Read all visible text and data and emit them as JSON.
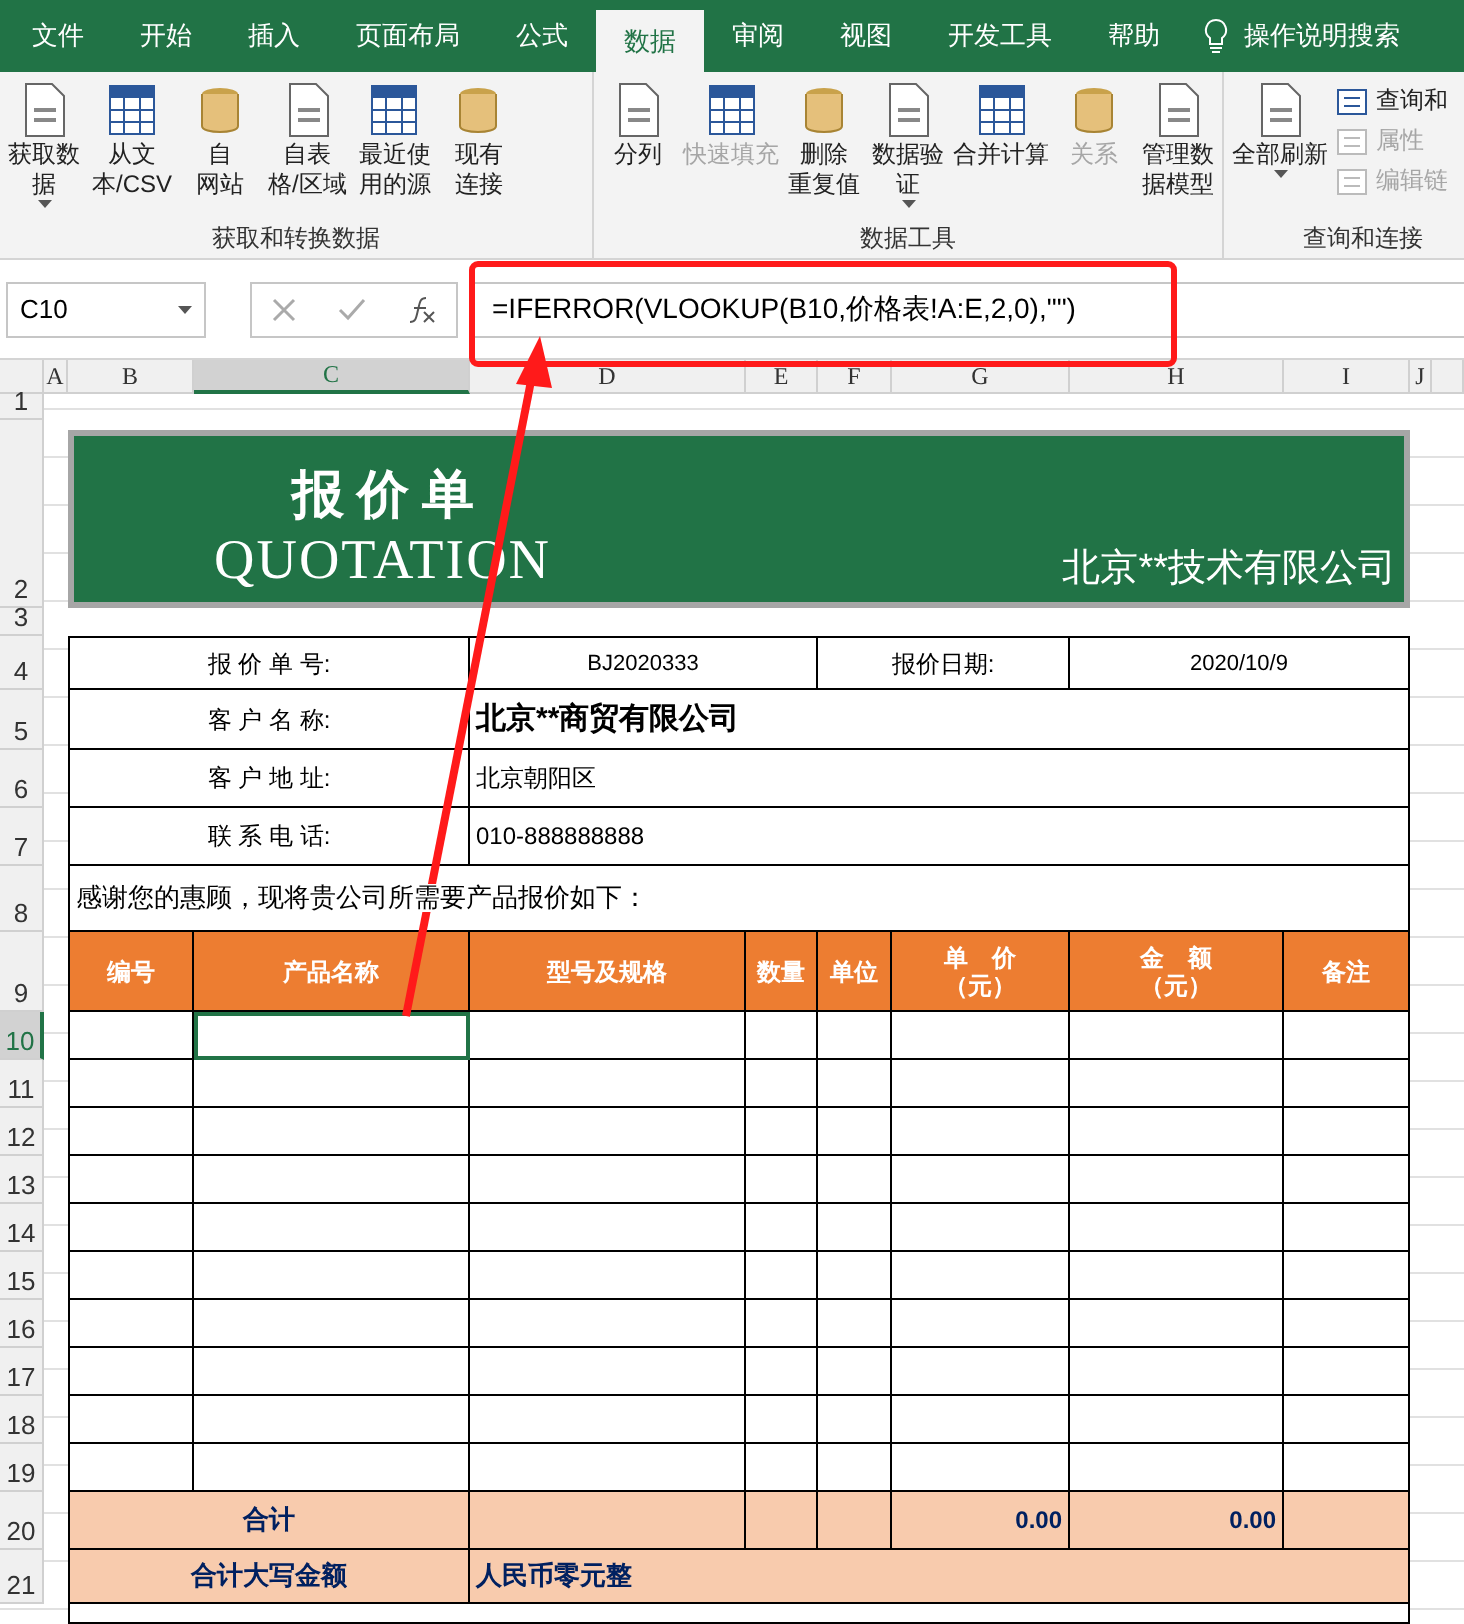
{
  "tabs": [
    {
      "label": "文件",
      "selected": false
    },
    {
      "label": "开始",
      "selected": false
    },
    {
      "label": "插入",
      "selected": false
    },
    {
      "label": "页面布局",
      "selected": false
    },
    {
      "label": "公式",
      "selected": false
    },
    {
      "label": "数据",
      "selected": true
    },
    {
      "label": "审阅",
      "selected": false
    },
    {
      "label": "视图",
      "selected": false
    },
    {
      "label": "开发工具",
      "selected": false
    },
    {
      "label": "帮助",
      "selected": false
    }
  ],
  "search": {
    "label": "操作说明搜索"
  },
  "ribbon_groups": [
    {
      "label": "获取和转换数据",
      "buttons": [
        {
          "kind": "dropdown",
          "lines": [
            "获取数",
            "据"
          ],
          "disabled": false
        },
        {
          "kind": "large",
          "lines": [
            "从文",
            "本/CSV"
          ],
          "disabled": false
        },
        {
          "kind": "large",
          "lines": [
            "自",
            "网站"
          ],
          "disabled": false
        },
        {
          "kind": "large",
          "lines": [
            "自表",
            "格/区域"
          ],
          "disabled": false
        },
        {
          "kind": "large",
          "lines": [
            "最近使",
            "用的源"
          ],
          "disabled": false
        },
        {
          "kind": "large",
          "lines": [
            "现有",
            "连接"
          ],
          "disabled": false
        }
      ]
    },
    {
      "label": "数据工具",
      "buttons": [
        {
          "kind": "large",
          "lines": [
            "分列"
          ],
          "disabled": false
        },
        {
          "kind": "large",
          "lines": [
            "快速填充"
          ],
          "disabled": true
        },
        {
          "kind": "large",
          "lines": [
            "删除",
            "重复值"
          ],
          "disabled": false
        },
        {
          "kind": "dropdown",
          "lines": [
            "数据验",
            "证"
          ],
          "disabled": false
        },
        {
          "kind": "large",
          "lines": [
            "合并计算"
          ],
          "disabled": false
        },
        {
          "kind": "large",
          "lines": [
            "关系"
          ],
          "disabled": true
        },
        {
          "kind": "large",
          "lines": [
            "管理数",
            "据模型"
          ],
          "disabled": false
        }
      ]
    },
    {
      "label": "查询和连接",
      "buttons": [
        {
          "kind": "dropdown",
          "lines": [
            "全部刷新"
          ],
          "disabled": false
        },
        {
          "kind": "small",
          "lines": [
            "查询和"
          ],
          "disabled": false
        },
        {
          "kind": "small",
          "lines": [
            "属性"
          ],
          "disabled": true
        },
        {
          "kind": "small",
          "lines": [
            "编辑链"
          ],
          "disabled": true
        }
      ]
    }
  ],
  "name_box": "C10",
  "formula": "=IFERROR(VLOOKUP(B10,价格表!A:E,2,0),\"\")",
  "columns": [
    {
      "label": "A",
      "selected": false
    },
    {
      "label": "B",
      "selected": false
    },
    {
      "label": "C",
      "selected": true
    },
    {
      "label": "D",
      "selected": false
    },
    {
      "label": "E",
      "selected": false
    },
    {
      "label": "F",
      "selected": false
    },
    {
      "label": "G",
      "selected": false
    },
    {
      "label": "H",
      "selected": false
    },
    {
      "label": "I",
      "selected": false
    },
    {
      "label": "J",
      "selected": false
    }
  ],
  "rows": [
    {
      "label": "1",
      "selected": false
    },
    {
      "label": "2",
      "selected": false
    },
    {
      "label": "3",
      "selected": false
    },
    {
      "label": "4",
      "selected": false
    },
    {
      "label": "5",
      "selected": false
    },
    {
      "label": "6",
      "selected": false
    },
    {
      "label": "7",
      "selected": false
    },
    {
      "label": "8",
      "selected": false
    },
    {
      "label": "9",
      "selected": false
    },
    {
      "label": "10",
      "selected": true
    },
    {
      "label": "11",
      "selected": false
    },
    {
      "label": "12",
      "selected": false
    },
    {
      "label": "13",
      "selected": false
    },
    {
      "label": "14",
      "selected": false
    },
    {
      "label": "15",
      "selected": false
    },
    {
      "label": "16",
      "selected": false
    },
    {
      "label": "17",
      "selected": false
    },
    {
      "label": "18",
      "selected": false
    },
    {
      "label": "19",
      "selected": false
    },
    {
      "label": "20",
      "selected": false
    },
    {
      "label": "21",
      "selected": false
    }
  ],
  "quote": {
    "title": "报 价 单",
    "subtitle": "QUOTATION",
    "company": "北京**技术有限公司",
    "number_label": "报 价 单 号:",
    "number": "BJ2020333",
    "date_label": "报价日期:",
    "date": "2020/10/9",
    "info": [
      {
        "label": "客 户 名 称:",
        "value": "北京**商贸有限公司",
        "bold": true
      },
      {
        "label": "客 户 地 址:",
        "value": "北京朝阳区",
        "bold": false
      },
      {
        "label": "联 系 电 话:",
        "value": "010-888888888",
        "bold": false
      }
    ],
    "intro": "感谢您的惠顾，现将贵公司所需要产品报价如下：",
    "headers": [
      {
        "text": "编号"
      },
      {
        "text": "产品名称"
      },
      {
        "text": "型号及规格"
      },
      {
        "text": "数量"
      },
      {
        "text": "单位"
      },
      {
        "text": "单　价",
        "unit": "（元）"
      },
      {
        "text": "金　额",
        "unit": "（元）"
      },
      {
        "text": "备注"
      }
    ],
    "total_label": "合计",
    "total_price": "0.00",
    "total_amount": "0.00",
    "words_label": "合计大写金额",
    "words_value": "人民币零元整"
  }
}
